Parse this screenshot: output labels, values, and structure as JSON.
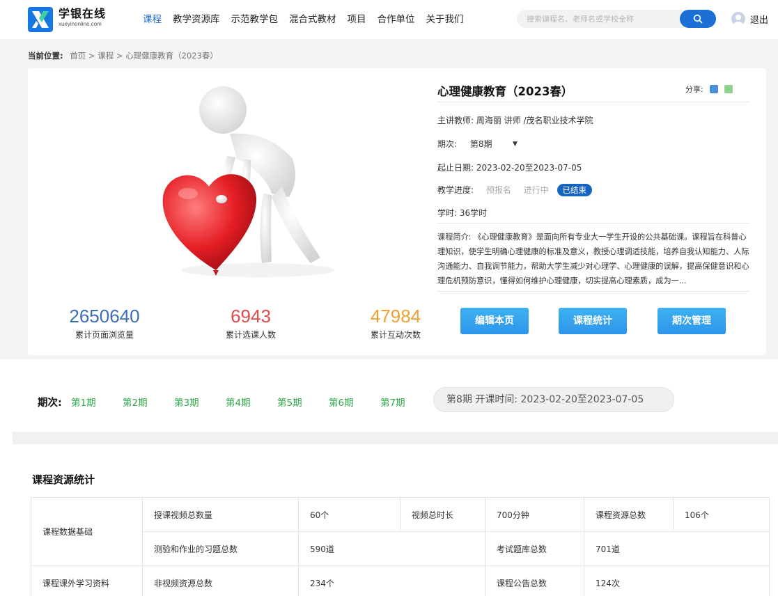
{
  "header": {
    "brand_name": "学银在线",
    "brand_domain": "xueyinonline.com",
    "nav": [
      "课程",
      "教学资源库",
      "示范教学包",
      "混合式教材",
      "项目",
      "合作单位",
      "关于我们"
    ],
    "search_placeholder": "搜索课程名、老师名或学校全称",
    "logout": "退出"
  },
  "breadcrumb": {
    "label": "当前位置:",
    "path": "首页 > 课程 > 心理健康教育（2023春）"
  },
  "course": {
    "title": "心理健康教育（2023春）",
    "share_label": "分享:",
    "teacher": "主讲教师: 周海丽 讲师 /茂名职业技术学院",
    "term_label": "期次:",
    "term_value": "第8期",
    "date_range": "起止日期: 2023-02-20至2023-07-05",
    "progress_label": "教学进度:",
    "progress_steps": [
      "预报名",
      "进行中",
      "已结束"
    ],
    "hours": "学时: 36学时",
    "intro": "课程简介: 《心理健康教育》是面向所有专业大一学生开设的公共基础课。课程旨在科普心理知识，使学生明确心理健康的标准及意义，教授心理调适技能，培养自我认知能力、人际沟通能力、自我调节能力，帮助大学生减少对心理学、心理健康的误解，提高保健意识和心理危机预防意识，懂得如何维护心理健康，切实提高心理素质，成为一..."
  },
  "stats": [
    {
      "value": "2650640",
      "label": "累计页面浏览量",
      "color": "#3a6eb5"
    },
    {
      "value": "6943",
      "label": "累计选课人数",
      "color": "#e04a4a"
    },
    {
      "value": "47984",
      "label": "累计互动次数",
      "color": "#f0a030"
    }
  ],
  "actions": [
    "编辑本页",
    "课程统计",
    "期次管理"
  ],
  "terms": {
    "label": "期次:",
    "items": [
      "第1期",
      "第2期",
      "第3期",
      "第4期",
      "第5期",
      "第6期",
      "第7期"
    ],
    "current": "第8期  开课时间: 2023-02-20至2023-07-05"
  },
  "resources": {
    "title": "课程资源统计",
    "rows": {
      "basic": "课程数据基础",
      "video_count_label": "授课视频总数量",
      "video_count": "60个",
      "video_duration_label": "视频总时长",
      "video_duration": "700分钟",
      "resource_total_label": "课程资源总数",
      "resource_total": "106个",
      "exercise_label": "测验和作业的习题总数",
      "exercise": "590道",
      "exam_label": "考试题库总数",
      "exam": "701道",
      "extra": "课程课外学习资料",
      "nonvideo_label": "非视频资源总数",
      "nonvideo": "234个",
      "notice_label": "课程公告总数",
      "notice": "124次"
    }
  },
  "colors": {
    "accent": "#1b6fd6",
    "term_link": "#31a94a",
    "button": "#3aa8f0"
  }
}
